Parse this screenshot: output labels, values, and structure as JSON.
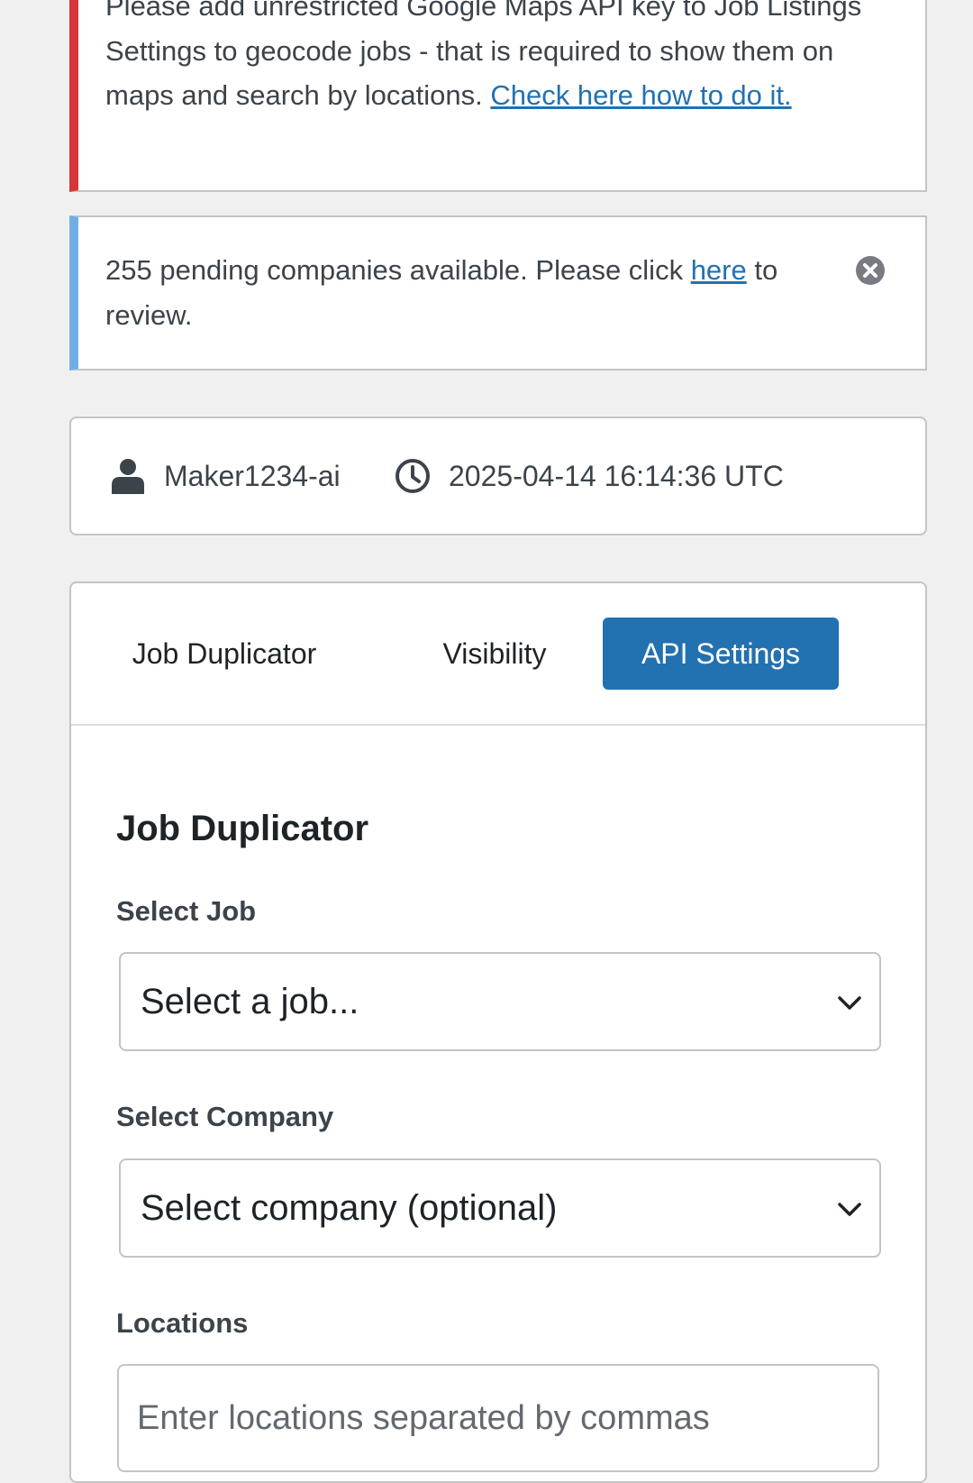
{
  "notices": {
    "error": {
      "text": "Please add unrestricted Google Maps API key to Job Listings Settings to geocode jobs - that is required to show them on maps and search by locations. ",
      "link": "Check here how to do it."
    },
    "info": {
      "text_before": "255 pending companies available. Please click ",
      "link": "here",
      "text_after": " to review."
    }
  },
  "meta": {
    "username": "Maker1234-ai",
    "datetime": "2025-04-14 16:14:36 UTC"
  },
  "tabs": [
    {
      "label": "Job Duplicator",
      "active": false
    },
    {
      "label": "Visibility",
      "active": false
    },
    {
      "label": "API Settings",
      "active": true
    }
  ],
  "form": {
    "title": "Job Duplicator",
    "job_label": "Select Job",
    "job_value": "Select a job...",
    "company_label": "Select Company",
    "company_value": "Select company (optional)",
    "locations_label": "Locations",
    "locations_placeholder": "Enter locations separated by commas"
  },
  "colors": {
    "error_border": "#d63638",
    "info_border": "#72aee6",
    "accent": "#2271b1",
    "background": "#f0f0f1"
  },
  "icons": {
    "user": "user-icon",
    "clock": "clock-icon",
    "dismiss": "dismiss-icon",
    "chevron": "chevron-down-icon"
  }
}
